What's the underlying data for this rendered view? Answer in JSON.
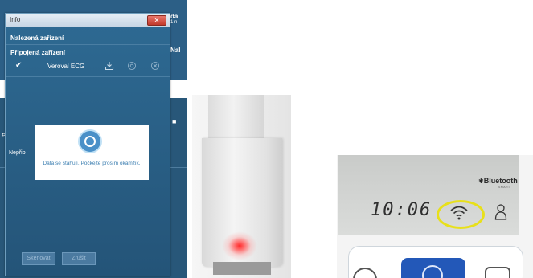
{
  "background_app": {
    "header_fragment": "da",
    "header_fragment2": "1 n",
    "side_label": "Nal",
    "left_cut_label": "Po",
    "row_cut_label": "Nepřip"
  },
  "dialog": {
    "title": "Info",
    "close_symbol": "✕",
    "found_devices_label": "Nalezená zařízení",
    "connected_devices_label": "Připojená zařízení",
    "device": {
      "name": "Veroval ECG",
      "check_symbol": "✔",
      "icons": [
        "download-icon",
        "settings-icon",
        "close-circle-icon"
      ]
    },
    "modal_message": "Data se stahují. Počkejte prosím okamžik.",
    "scan_button": "Skenovat",
    "cancel_button": "Zrušit"
  },
  "bp_monitor": {
    "brand_label": "Bluetooth",
    "brand_sub": "SMART",
    "time_display": "10:06",
    "highlight_color": "#e8e01a"
  },
  "colors": {
    "app_blue": "#2c5f86",
    "accent_blue": "#3d7fb1",
    "led_red": "#ff2a2a",
    "device_button_blue": "#2358b8"
  }
}
